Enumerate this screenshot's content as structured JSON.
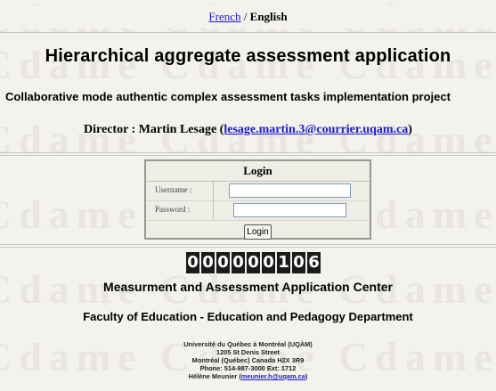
{
  "language": {
    "french": "French",
    "separator": "/",
    "english": "English"
  },
  "title": "Hierarchical aggregate assessment application",
  "subtitle": "Collaborative mode authentic complex assessment tasks implementation project",
  "director": {
    "prefix": "Director : Martin Lesage (",
    "email": "lesage.martin.3@courrier.uqam.ca",
    "suffix": ")"
  },
  "login": {
    "heading": "Login",
    "username_label": "Username :",
    "password_label": "Password :",
    "username_value": "",
    "password_value": "",
    "button": "Login"
  },
  "counter": {
    "digits": [
      "0",
      "0",
      "0",
      "0",
      "0",
      "0",
      "1",
      "0",
      "6"
    ]
  },
  "center_name": "Measurment and Assessment Application Center",
  "faculty": "Faculty of Education - Education and Pedagogy Department",
  "address": {
    "university": "Université du Québec à Montréal (UQÀM)",
    "street": "1205 St Denis Street",
    "city": "Montréal (Québec) Canada H2X 3R9",
    "phone": "Phone: 514-987-3000 Ext: 1712",
    "contact_prefix": "Hélène Meunier (",
    "contact_email": "meunier.h@uqam.ca",
    "contact_suffix": ")"
  }
}
